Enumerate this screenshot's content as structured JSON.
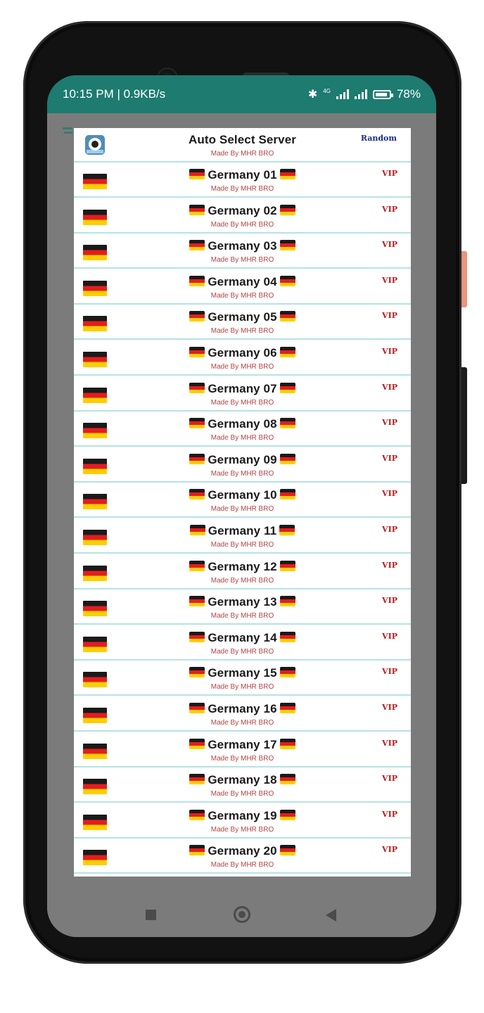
{
  "status_bar": {
    "time_speed": "10:15 PM | 0.9KB/s",
    "network_label": "4G",
    "battery": "78%"
  },
  "dialog": {
    "header": {
      "title": "Auto Select Server",
      "subtitle": "Made By MHR BRO",
      "badge": "Random",
      "icon": "app-logo-icon"
    },
    "servers": [
      {
        "name": "Germany 01",
        "subtitle": "Made By MHR BRO",
        "badge": "VIP"
      },
      {
        "name": "Germany 02",
        "subtitle": "Made By MHR BRO",
        "badge": "VIP"
      },
      {
        "name": "Germany 03",
        "subtitle": "Made By MHR BRO",
        "badge": "VIP"
      },
      {
        "name": "Germany 04",
        "subtitle": "Made By MHR BRO",
        "badge": "VIP"
      },
      {
        "name": "Germany 05",
        "subtitle": "Made By MHR BRO",
        "badge": "VIP"
      },
      {
        "name": "Germany 06",
        "subtitle": "Made By MHR BRO",
        "badge": "VIP"
      },
      {
        "name": "Germany 07",
        "subtitle": "Made By MHR BRO",
        "badge": "VIP"
      },
      {
        "name": "Germany 08",
        "subtitle": "Made By MHR BRO",
        "badge": "VIP"
      },
      {
        "name": "Germany 09",
        "subtitle": "Made By MHR BRO",
        "badge": "VIP"
      },
      {
        "name": "Germany 10",
        "subtitle": "Made By MHR BRO",
        "badge": "VIP"
      },
      {
        "name": "Germany 11",
        "subtitle": "Made By MHR BRO",
        "badge": "VIP"
      },
      {
        "name": "Germany 12",
        "subtitle": "Made By MHR BRO",
        "badge": "VIP"
      },
      {
        "name": "Germany 13",
        "subtitle": "Made By MHR BRO",
        "badge": "VIP"
      },
      {
        "name": "Germany 14",
        "subtitle": "Made By MHR BRO",
        "badge": "VIP"
      },
      {
        "name": "Germany 15",
        "subtitle": "Made By MHR BRO",
        "badge": "VIP"
      },
      {
        "name": "Germany 16",
        "subtitle": "Made By MHR BRO",
        "badge": "VIP"
      },
      {
        "name": "Germany 17",
        "subtitle": "Made By MHR BRO",
        "badge": "VIP"
      },
      {
        "name": "Germany 18",
        "subtitle": "Made By MHR BRO",
        "badge": "VIP"
      },
      {
        "name": "Germany 19",
        "subtitle": "Made By MHR BRO",
        "badge": "VIP"
      },
      {
        "name": "Germany 20",
        "subtitle": "Made By MHR BRO",
        "badge": "VIP"
      }
    ]
  },
  "nav_bar": {
    "recent_icon": "square-icon",
    "home_icon": "circle-icon",
    "back_icon": "triangle-back-icon"
  },
  "colors": {
    "status_bar": "#1d7b70",
    "vip": "#b81e1e",
    "random": "#1e2a8a",
    "subtitle": "#b04545",
    "row_divider": "#b5e3e3"
  }
}
